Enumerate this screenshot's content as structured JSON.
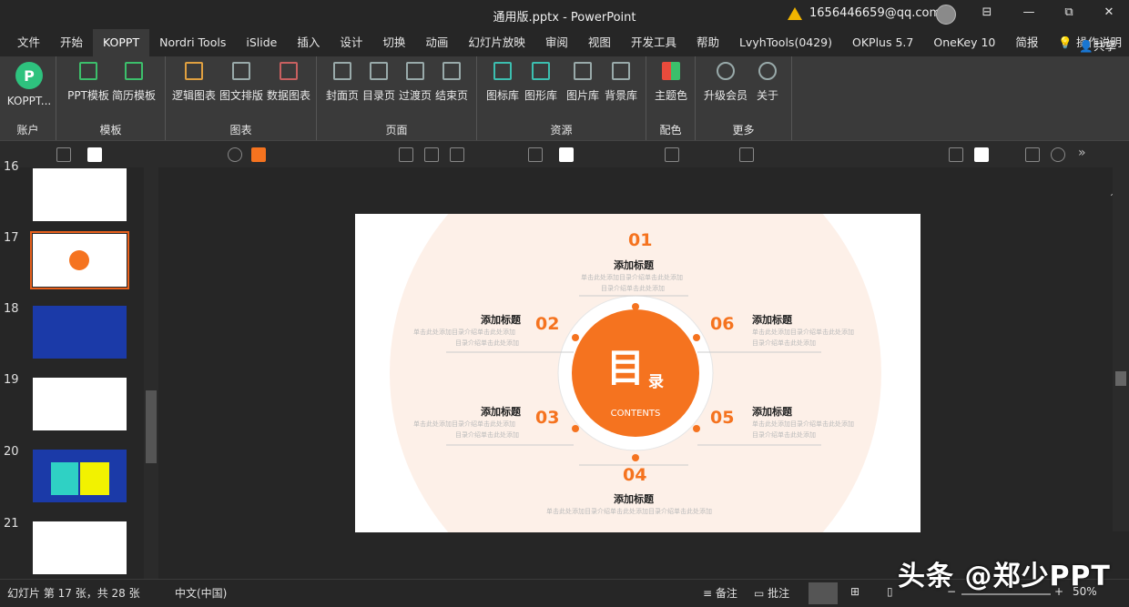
{
  "window": {
    "title": "通用版.pptx  -  PowerPoint",
    "account": "1656446659@qq.com",
    "min": "🗗",
    "restore": "⧉",
    "close": "✕",
    "accent": "#f5731f"
  },
  "tabs": [
    "文件",
    "开始",
    "KOPPT",
    "Nordri Tools",
    "iSlide",
    "插入",
    "设计",
    "切换",
    "动画",
    "幻灯片放映",
    "审阅",
    "视图",
    "开发工具",
    "帮助",
    "LvyhTools(0429)",
    "OKPlus 5.7",
    "OneKey 10",
    "简报"
  ],
  "tab_extra": {
    "tellme": "操作说明",
    "share": "共享"
  },
  "ribbon": {
    "account": {
      "btn": "KOPPT...",
      "label": "账户"
    },
    "template": {
      "b1": "PPT模板",
      "b2": "简历模板",
      "label": "模板"
    },
    "chart": {
      "b1": "逻辑图表",
      "b2": "图文排版",
      "b3": "数据图表",
      "label": "图表"
    },
    "page": {
      "b1": "封面页",
      "b2": "目录页",
      "b3": "过渡页",
      "b4": "结束页",
      "label": "页面"
    },
    "resource": {
      "b1": "图标库",
      "b2": "图形库",
      "b3": "图片库",
      "b4": "背景库",
      "label": "资源"
    },
    "color": {
      "b1": "主题色",
      "label": "配色"
    },
    "more": {
      "b1": "升级会员",
      "b2": "关于",
      "label": "更多"
    }
  },
  "slides": [
    "16",
    "17",
    "18",
    "19",
    "20",
    "21"
  ],
  "slide": {
    "center_char": "目",
    "center_small": "录",
    "contents": "CONTENTS",
    "items": [
      {
        "num": "01",
        "title": "添加标题",
        "d1": "单击此处添加目录介绍单击此处添加",
        "d2": "目录介绍单击此处添加"
      },
      {
        "num": "02",
        "title": "添加标题",
        "d1": "单击此处添加目录介绍单击此处添加",
        "d2": "目录介绍单击此处添加"
      },
      {
        "num": "03",
        "title": "添加标题",
        "d1": "单击此处添加目录介绍单击此处添加",
        "d2": "目录介绍单击此处添加"
      },
      {
        "num": "04",
        "title": "添加标题",
        "d1": "单击此处添加目录介绍单击此处添加目录介绍单击此处添加"
      },
      {
        "num": "05",
        "title": "添加标题",
        "d1": "单击此处添加目录介绍单击此处添加",
        "d2": "目录介绍单击此处添加"
      },
      {
        "num": "06",
        "title": "添加标题",
        "d1": "单击此处添加目录介绍单击此处添加",
        "d2": "目录介绍单击此处添加"
      }
    ]
  },
  "status": {
    "slide_info": "幻灯片 第 17 张，共 28 张",
    "lang": "中文(中国)",
    "notes": "备注",
    "comments": "批注",
    "zoom": "50%"
  },
  "watermark": "头条 @郑少PPT"
}
